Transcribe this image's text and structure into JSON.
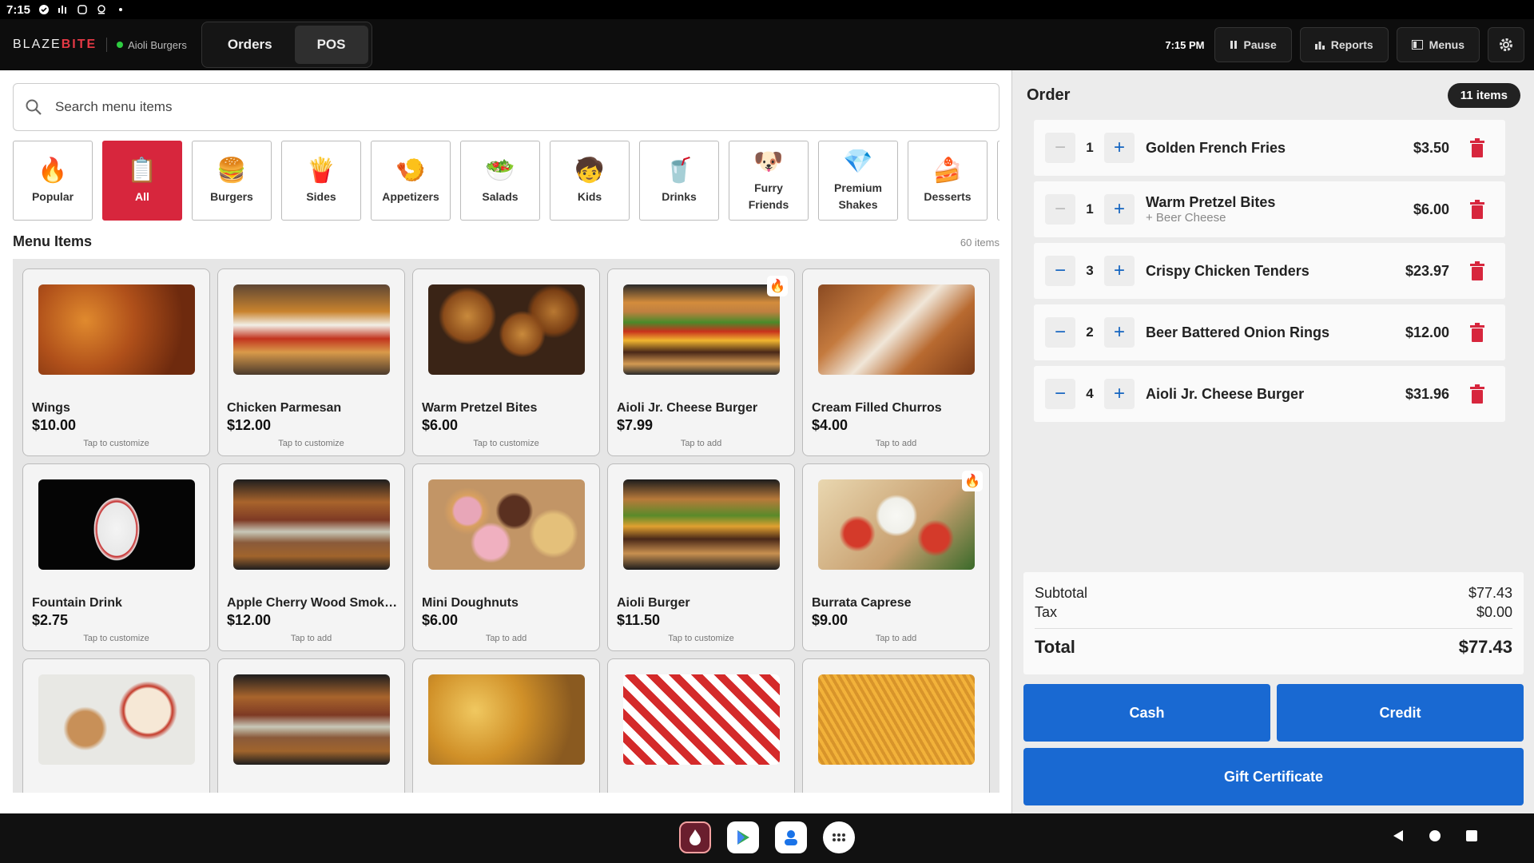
{
  "status": {
    "time": "7:15"
  },
  "header": {
    "brand_prefix": "BLAZE",
    "brand_suffix": "BITE",
    "location": "Aioli Burgers",
    "tabs": [
      {
        "label": "Orders"
      },
      {
        "label": "POS"
      }
    ],
    "clock": "7:15 PM",
    "pause_label": "Pause",
    "reports_label": "Reports",
    "menus_label": "Menus"
  },
  "search": {
    "placeholder": "Search menu items"
  },
  "categories": [
    {
      "label": "Popular",
      "icon": "🔥"
    },
    {
      "label": "All",
      "icon": "📋"
    },
    {
      "label": "Burgers",
      "icon": "🍔"
    },
    {
      "label": "Sides",
      "icon": "🍟"
    },
    {
      "label": "Appetizers",
      "icon": "🍤"
    },
    {
      "label": "Salads",
      "icon": "🥗"
    },
    {
      "label": "Kids",
      "icon": "🧒"
    },
    {
      "label": "Drinks",
      "icon": "🥤"
    },
    {
      "label": "Furry Friends",
      "icon": "🐶"
    },
    {
      "label": "Premium Shakes",
      "icon": "💎"
    },
    {
      "label": "Desserts",
      "icon": "🍰"
    }
  ],
  "menu": {
    "title": "Menu Items",
    "count": "60 items",
    "items": [
      {
        "name": "Wings",
        "price": "$10.00",
        "hint": "Tap to customize"
      },
      {
        "name": "Chicken Parmesan",
        "price": "$12.00",
        "hint": "Tap to customize"
      },
      {
        "name": "Warm Pretzel Bites",
        "price": "$6.00",
        "hint": "Tap to customize"
      },
      {
        "name": "Aioli Jr. Cheese Burger",
        "price": "$7.99",
        "hint": "Tap to add"
      },
      {
        "name": "Cream Filled Churros",
        "price": "$4.00",
        "hint": "Tap to add"
      },
      {
        "name": "Fountain Drink",
        "price": "$2.75",
        "hint": "Tap to customize"
      },
      {
        "name": "Apple Cherry Wood Smoke...",
        "price": "$12.00",
        "hint": "Tap to add"
      },
      {
        "name": "Mini Doughnuts",
        "price": "$6.00",
        "hint": "Tap to add"
      },
      {
        "name": "Aioli Burger",
        "price": "$11.50",
        "hint": "Tap to customize"
      },
      {
        "name": "Burrata Caprese",
        "price": "$9.00",
        "hint": "Tap to add"
      }
    ]
  },
  "order": {
    "title": "Order",
    "badge": "11 items",
    "lines": [
      {
        "qty": "1",
        "name": "Golden French Fries",
        "modifier": "",
        "price": "$3.50"
      },
      {
        "qty": "1",
        "name": "Warm Pretzel Bites",
        "modifier": "+ Beer Cheese",
        "price": "$6.00"
      },
      {
        "qty": "3",
        "name": "Crispy Chicken Tenders",
        "modifier": "",
        "price": "$23.97"
      },
      {
        "qty": "2",
        "name": "Beer Battered Onion Rings",
        "modifier": "",
        "price": "$12.00"
      },
      {
        "qty": "4",
        "name": "Aioli Jr. Cheese Burger",
        "modifier": "",
        "price": "$31.96"
      }
    ],
    "subtotal_label": "Subtotal",
    "subtotal": "$77.43",
    "tax_label": "Tax",
    "tax": "$0.00",
    "total_label": "Total",
    "total": "$77.43",
    "cash_label": "Cash",
    "credit_label": "Credit",
    "gift_label": "Gift Certificate"
  },
  "colors": {
    "accent": "#d7263d",
    "pay": "#1969d2",
    "qty_icon": "#1565c0"
  }
}
